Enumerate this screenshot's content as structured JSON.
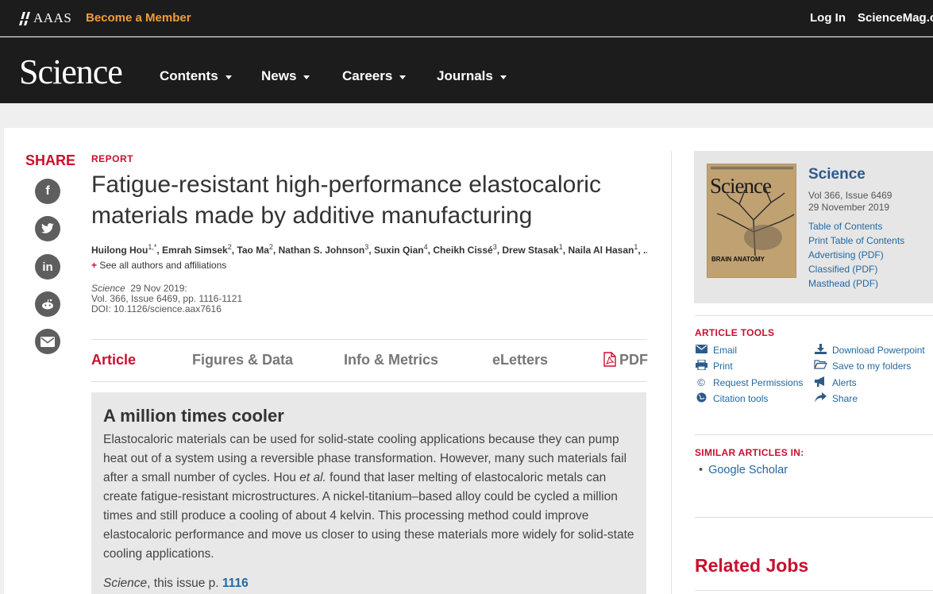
{
  "topbar": {
    "org": "AAAS",
    "become_member": "Become a Member",
    "login": "Log In",
    "sciencemag": "ScienceMag.org"
  },
  "nav": {
    "logo": "Science",
    "items": [
      {
        "label": "Contents",
        "icon": "chevron-down-icon"
      },
      {
        "label": "News",
        "icon": "chevron-down-icon"
      },
      {
        "label": "Careers",
        "icon": "chevron-down-icon"
      },
      {
        "label": "Journals",
        "icon": "chevron-down-icon"
      }
    ]
  },
  "share": {
    "label": "SHARE",
    "icons": [
      "facebook-icon",
      "twitter-icon",
      "linkedin-icon",
      "reddit-icon",
      "email-icon"
    ]
  },
  "article": {
    "type": "REPORT",
    "title": "Fatigue-resistant high-performance elastocaloric materials made by additive manufacturing",
    "authors": [
      {
        "name": "Huilong Hou",
        "sup": "1,*"
      },
      {
        "name": "Emrah Simsek",
        "sup": "2"
      },
      {
        "name": "Tao Ma",
        "sup": "2"
      },
      {
        "name": "Nathan S. Johnson",
        "sup": "3"
      },
      {
        "name": "Suxin Qian",
        "sup": "4"
      },
      {
        "name": "Cheikh Cissé",
        "sup": "3"
      },
      {
        "name": "Drew Stasak",
        "sup": "1"
      },
      {
        "name": "Naila Al Hasan",
        "sup": "1"
      }
    ],
    "authors_more": "...",
    "see_all": "See all authors and affiliations",
    "see_all_prefix": "+",
    "journal": "Science",
    "date": "29 Nov 2019:",
    "volume_line": "Vol. 366, Issue 6469, pp. 1116-1121",
    "doi": "DOI: 10.1126/science.aax7616"
  },
  "tabs": {
    "article": "Article",
    "figures": "Figures & Data",
    "info": "Info & Metrics",
    "eletters": "eLetters",
    "pdf": "PDF"
  },
  "abstract": {
    "heading": "A million times cooler",
    "text_before": "Elastocaloric materials can be used for solid-state cooling applications because they can pump heat out of a system using a reversible phase transformation. However, many such materials fail after a small number of cycles. Hou ",
    "text_italic": "et al.",
    "text_after": " found that laser melting of elastocaloric metals can create fatigue-resistant microstructures. A nickel-titanium–based alloy could be cycled a million times and still produce a cooling of about 4 kelvin. This processing method could improve elastocaloric performance and move us closer to using these materials more widely for solid-state cooling applications.",
    "cite_journal": "Science",
    "cite_text": ", this issue p. ",
    "cite_page": "1116"
  },
  "issue": {
    "name": "Science",
    "vol": "Vol 366, Issue 6469",
    "date": "29 November 2019",
    "cover_title": "Science",
    "cover_caption": "BRAIN ANATOMY",
    "links": [
      "Table of Contents",
      "Print Table of Contents",
      "Advertising (PDF)",
      "Classified (PDF)",
      "Masthead (PDF)"
    ]
  },
  "tools": {
    "heading": "ARTICLE TOOLS",
    "left": [
      {
        "label": "Email",
        "icon": "email-icon"
      },
      {
        "label": "Print",
        "icon": "print-icon"
      },
      {
        "label": "Request Permissions",
        "icon": "copyright-icon"
      },
      {
        "label": "Citation tools",
        "icon": "globe-icon"
      }
    ],
    "right": [
      {
        "label": "Download Powerpoint",
        "icon": "download-icon"
      },
      {
        "label": "Save to my folders",
        "icon": "folder-icon"
      },
      {
        "label": "Alerts",
        "icon": "megaphone-icon"
      },
      {
        "label": "Share",
        "icon": "share-icon"
      }
    ]
  },
  "similar": {
    "heading": "SIMILAR ARTICLES IN:",
    "items": [
      "Google Scholar"
    ]
  },
  "related": {
    "heading": "Related Jobs"
  },
  "colors": {
    "accent_red": "#c8102e",
    "link_blue": "#2468a2",
    "member_orange": "#f39c39",
    "header_dark": "#1c1c1c"
  }
}
